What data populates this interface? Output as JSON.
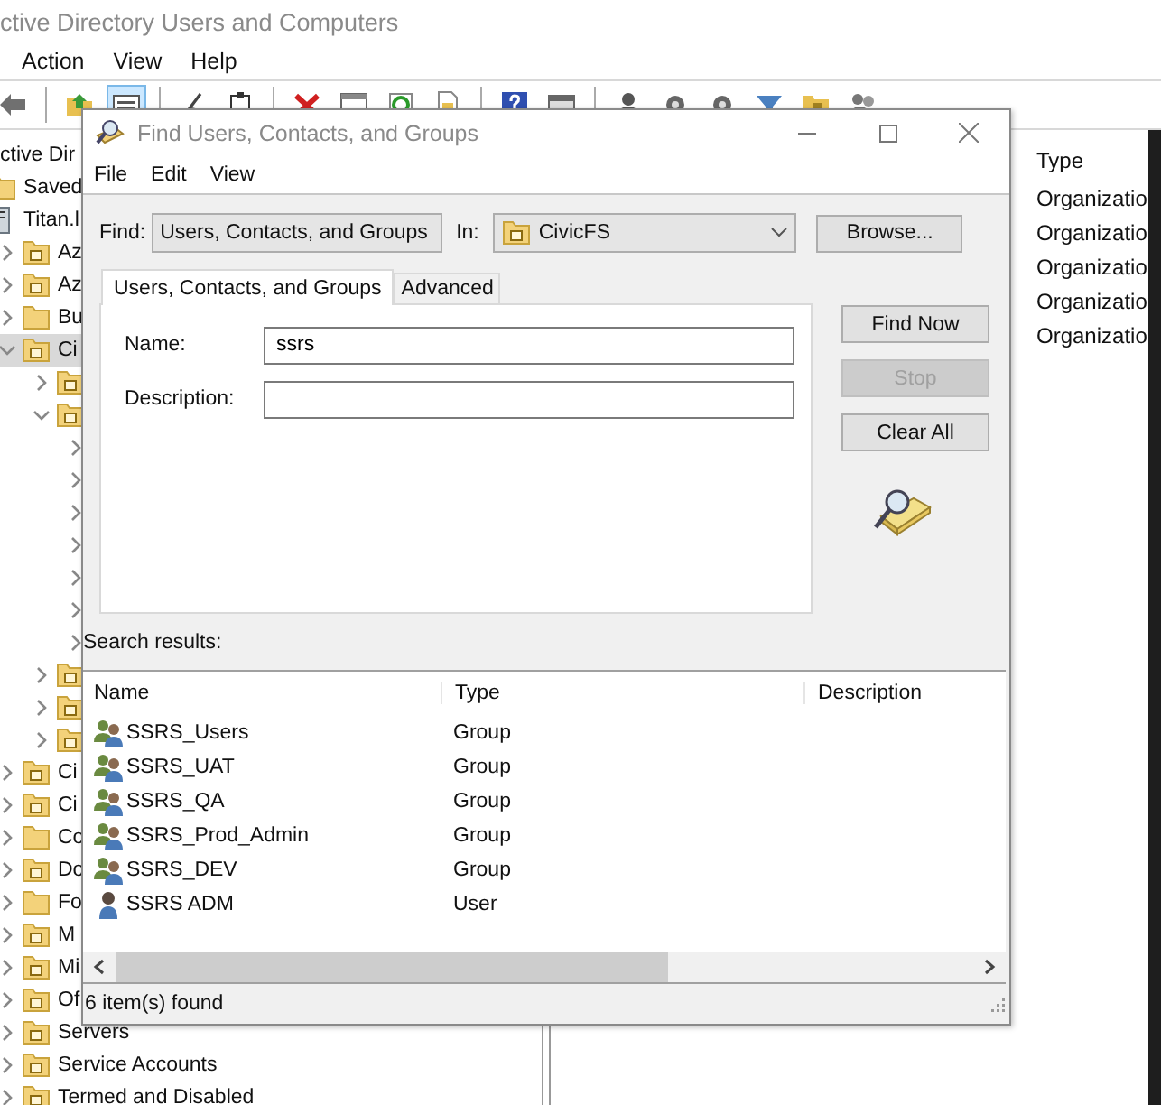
{
  "window": {
    "title": "ctive Directory Users and Computers"
  },
  "menu": [
    "Action",
    "View",
    "Help"
  ],
  "toolbar": [
    {
      "kind": "back",
      "pressed": false
    },
    {
      "kind": "sep"
    },
    {
      "kind": "folder-up",
      "pressed": false
    },
    {
      "kind": "list",
      "pressed": true
    },
    {
      "kind": "sep"
    },
    {
      "kind": "pen",
      "pressed": false
    },
    {
      "kind": "clipboard",
      "pressed": false
    },
    {
      "kind": "sep"
    },
    {
      "kind": "delete",
      "pressed": false
    },
    {
      "kind": "window",
      "pressed": false
    },
    {
      "kind": "refresh",
      "pressed": false
    },
    {
      "kind": "document",
      "pressed": false
    },
    {
      "kind": "sep"
    },
    {
      "kind": "help",
      "pressed": false
    },
    {
      "kind": "console",
      "pressed": false
    },
    {
      "kind": "sep"
    },
    {
      "kind": "user",
      "pressed": false
    },
    {
      "kind": "gear",
      "pressed": false
    },
    {
      "kind": "gear",
      "pressed": false
    },
    {
      "kind": "filter",
      "pressed": false
    },
    {
      "kind": "folder",
      "pressed": false
    },
    {
      "kind": "users",
      "pressed": false
    }
  ],
  "tree": [
    {
      "label": "ctive Dir",
      "selected": false,
      "children": [
        {
          "label": "Saved",
          "kind": "folder",
          "selected": false
        },
        {
          "label": "Titan.l",
          "kind": "domain",
          "selected": false,
          "children": [
            {
              "label": "Az",
              "kind": "ou",
              "expanded": false,
              "selected": false
            },
            {
              "label": "Az",
              "kind": "ou",
              "expanded": false,
              "selected": false
            },
            {
              "label": "Bu",
              "kind": "folder",
              "expanded": false,
              "selected": false
            },
            {
              "label": "Ci",
              "kind": "ou",
              "expanded": true,
              "selected": true,
              "children": [
                {
                  "kind": "ou",
                  "expanded": false,
                  "selected": false
                },
                {
                  "kind": "ou",
                  "expanded": true,
                  "selected": false,
                  "children": [
                    {
                      "expanded": false,
                      "selected": false
                    },
                    {
                      "expanded": false,
                      "selected": false
                    },
                    {
                      "expanded": false,
                      "selected": false
                    },
                    {
                      "expanded": false,
                      "selected": false
                    },
                    {
                      "expanded": false,
                      "selected": false
                    },
                    {
                      "expanded": false,
                      "selected": false
                    },
                    {
                      "expanded": false,
                      "selected": false
                    }
                  ]
                },
                {
                  "kind": "ou",
                  "expanded": false,
                  "selected": false
                },
                {
                  "kind": "ou",
                  "expanded": false,
                  "selected": false
                },
                {
                  "kind": "ou",
                  "expanded": false,
                  "selected": false
                }
              ]
            },
            {
              "label": "Ci",
              "kind": "ou",
              "expanded": false,
              "selected": false
            },
            {
              "label": "Ci",
              "kind": "ou",
              "expanded": false,
              "selected": false
            },
            {
              "label": "Co",
              "kind": "folder",
              "expanded": false,
              "selected": false
            },
            {
              "label": "Do",
              "kind": "ou",
              "expanded": false,
              "selected": false
            },
            {
              "label": "Fo",
              "kind": "folder",
              "expanded": false,
              "selected": false
            },
            {
              "label": "M",
              "kind": "ou",
              "expanded": false,
              "selected": false
            },
            {
              "label": "Mi",
              "kind": "ou",
              "expanded": false,
              "selected": false
            },
            {
              "label": "Of",
              "kind": "ou",
              "expanded": false,
              "selected": false
            },
            {
              "label": "Servers",
              "kind": "ou",
              "expanded": false,
              "selected": false
            },
            {
              "label": "Service Accounts",
              "kind": "ou",
              "expanded": false,
              "selected": false
            },
            {
              "label": "Termed and Disabled",
              "kind": "ou",
              "expanded": false,
              "selected": false
            }
          ]
        }
      ]
    }
  ],
  "right_pane": {
    "column": "Type",
    "cells": [
      "Organizatio",
      "Organizatio",
      "Organizatio",
      "Organizatio",
      "Organizatio"
    ]
  },
  "dialog": {
    "title": "Find Users, Contacts, and Groups",
    "menu": [
      "File",
      "Edit",
      "View"
    ],
    "find_label": "Find:",
    "find_value": "Users, Contacts, and Groups",
    "in_label": "In:",
    "in_value": "CivicFS",
    "browse": "Browse...",
    "tabs": [
      {
        "label": "Users, Contacts, and Groups",
        "selected": true
      },
      {
        "label": "Advanced",
        "selected": false
      }
    ],
    "fields": [
      {
        "label": "Name:",
        "value": "ssrs"
      },
      {
        "label": "Description:"
      }
    ],
    "buttons": [
      {
        "label": "Find Now",
        "disabled": false
      },
      {
        "label": "Stop",
        "disabled": true
      },
      {
        "label": "Clear All",
        "disabled": false
      }
    ],
    "results_label": "Search results:",
    "columns": [
      "Name",
      "Type",
      "Description"
    ],
    "rows": [
      {
        "name": "SSRS_Users",
        "type": "Group",
        "kind": "group"
      },
      {
        "name": "SSRS_UAT",
        "type": "Group",
        "kind": "group"
      },
      {
        "name": "SSRS_QA",
        "type": "Group",
        "kind": "group"
      },
      {
        "name": "SSRS_Prod_Admin",
        "type": "Group",
        "kind": "group"
      },
      {
        "name": "SSRS_DEV",
        "type": "Group",
        "kind": "group"
      },
      {
        "name": "SSRS ADM",
        "type": "User",
        "kind": "user"
      }
    ],
    "status": "6 item(s) found"
  }
}
